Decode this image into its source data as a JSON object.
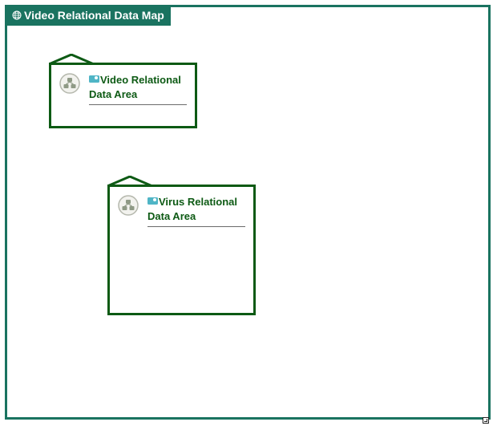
{
  "map": {
    "title": "Video Relational Data Map",
    "title_icon": "globe-icon",
    "accent_color": "#1a7360"
  },
  "areas": [
    {
      "label_line1": "Video Relational",
      "label_line2": "Data Area",
      "icon": "relational-node-icon",
      "badge_icon": "database-icon",
      "border_color": "#0d5a14"
    },
    {
      "label_line1": "Virus Relational",
      "label_line2": "Data Area",
      "icon": "relational-node-icon",
      "badge_icon": "database-icon",
      "border_color": "#0d5a14"
    }
  ],
  "corner_icon": "expand-icon"
}
